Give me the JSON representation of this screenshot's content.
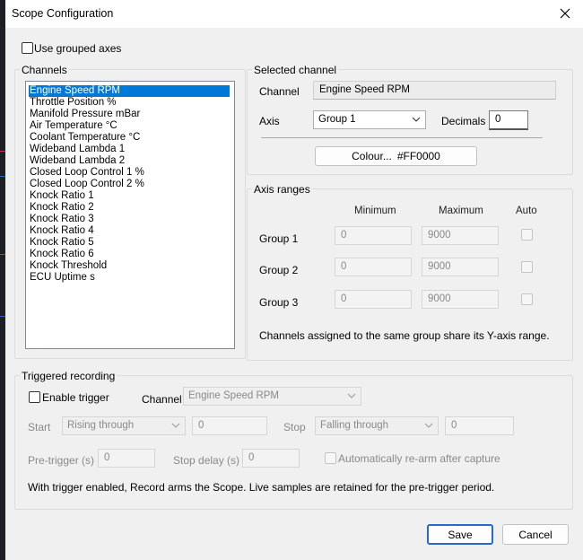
{
  "window": {
    "title": "Scope Configuration"
  },
  "use_grouped_axes": {
    "label": "Use grouped axes"
  },
  "channels": {
    "title": "Channels",
    "items": [
      "Engine Speed RPM",
      "Throttle Position %",
      "Manifold Pressure mBar",
      "Air Temperature °C",
      "Coolant Temperature °C",
      "Wideband Lambda 1",
      "Wideband Lambda 2",
      "Closed Loop Control 1 %",
      "Closed Loop Control 2 %",
      "Knock Ratio 1",
      "Knock Ratio 2",
      "Knock Ratio 3",
      "Knock Ratio 4",
      "Knock Ratio 5",
      "Knock Ratio 6",
      "Knock Threshold",
      "ECU Uptime s"
    ],
    "selected": "Engine Speed RPM"
  },
  "selected_channel": {
    "title": "Selected channel",
    "channel_label": "Channel",
    "channel_value": "Engine Speed RPM",
    "axis_label": "Axis",
    "axis_value": "Group 1",
    "decimals_label": "Decimals",
    "decimals_value": "0",
    "colour_button": "Colour...",
    "colour_value": "#FF0000"
  },
  "axis_ranges": {
    "title": "Axis ranges",
    "headers": {
      "minimum": "Minimum",
      "maximum": "Maximum",
      "auto": "Auto"
    },
    "rows": [
      {
        "label": "Group 1",
        "min": "0",
        "max": "9000"
      },
      {
        "label": "Group 2",
        "min": "0",
        "max": "9000"
      },
      {
        "label": "Group 3",
        "min": "0",
        "max": "9000"
      }
    ],
    "note": "Channels assigned to the same group share its Y-axis range."
  },
  "triggered": {
    "title": "Triggered recording",
    "enable_label": "Enable trigger",
    "channel_label": "Channel",
    "channel_value": "Engine Speed RPM",
    "start_label": "Start",
    "start_mode": "Rising through",
    "start_value": "0",
    "stop_label": "Stop",
    "stop_mode": "Falling through",
    "stop_value": "0",
    "pretrigger_label": "Pre-trigger (s)",
    "pretrigger_value": "0",
    "stopdelay_label": "Stop delay (s)",
    "stopdelay_value": "0",
    "rearm_label": "Automatically re-arm after capture",
    "note": "With trigger enabled, Record arms the Scope. Live samples are retained for the pre-trigger period."
  },
  "buttons": {
    "save": "Save",
    "cancel": "Cancel"
  },
  "colors": {
    "accent": "#0078d7",
    "selected_colour": "#FF0000"
  }
}
